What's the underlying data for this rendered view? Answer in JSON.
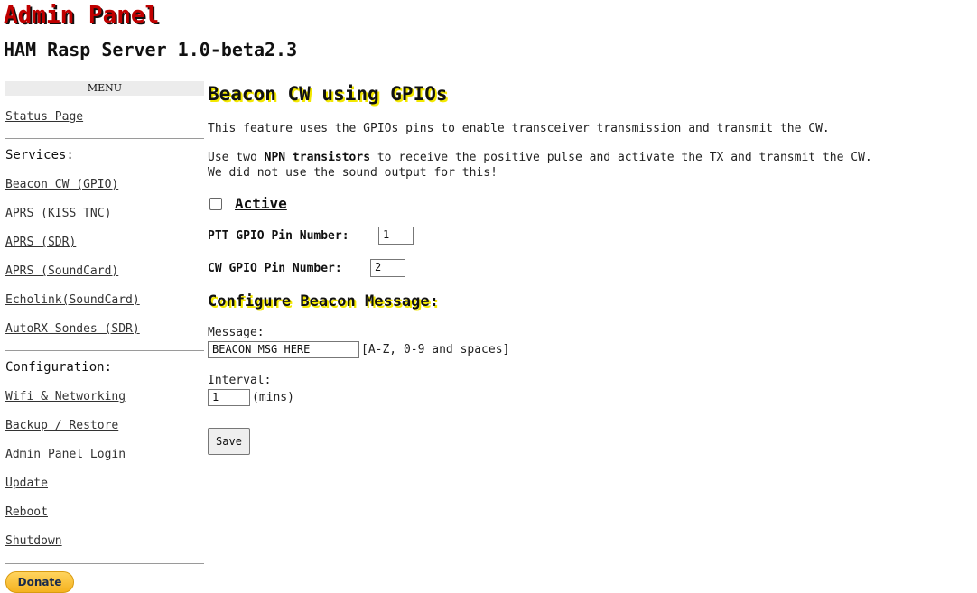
{
  "header": {
    "title": "Admin Panel",
    "subtitle": "HAM Rasp Server 1.0-beta2.3"
  },
  "sidebar": {
    "menu_label": "MENU",
    "status_link": "Status Page",
    "services_heading": "Services:",
    "services": [
      "Beacon CW (GPIO)",
      "APRS (KISS TNC)",
      "APRS (SDR)",
      "APRS (SoundCard)",
      "Echolink(SoundCard)",
      "AutoRX Sondes (SDR)"
    ],
    "config_heading": "Configuration:",
    "config": [
      "Wifi & Networking",
      "Backup / Restore",
      "Admin Panel Login",
      "Update",
      "Reboot",
      "Shutdown"
    ],
    "donate_label": "Donate"
  },
  "main": {
    "title": "Beacon CW using GPIOs",
    "intro": "This feature uses the GPIOs pins to enable transceiver transmission and transmit the CW.",
    "npn_prefix": "Use two ",
    "npn_bold": "NPN transistors",
    "npn_suffix": " to receive the positive pulse and activate the TX and transmit the CW.",
    "npn_line2": "We did not use the sound output for this!",
    "active_label": "Active",
    "active_checked": false,
    "ptt_label": "PTT GPIO Pin Number:",
    "ptt_value": "1",
    "cw_label": "CW GPIO Pin Number:",
    "cw_value": "2",
    "section_title": "Configure Beacon Message:",
    "message_label": "Message:",
    "message_value": "BEACON MSG HERE",
    "message_hint": "[A-Z, 0-9 and spaces]",
    "interval_label": "Interval:",
    "interval_value": "1",
    "interval_unit": "(mins)",
    "save_label": "Save"
  },
  "colors": {
    "title_red": "#c00000",
    "heading_highlight": "#f3e800",
    "donate_yellow": "#f5b21f"
  }
}
